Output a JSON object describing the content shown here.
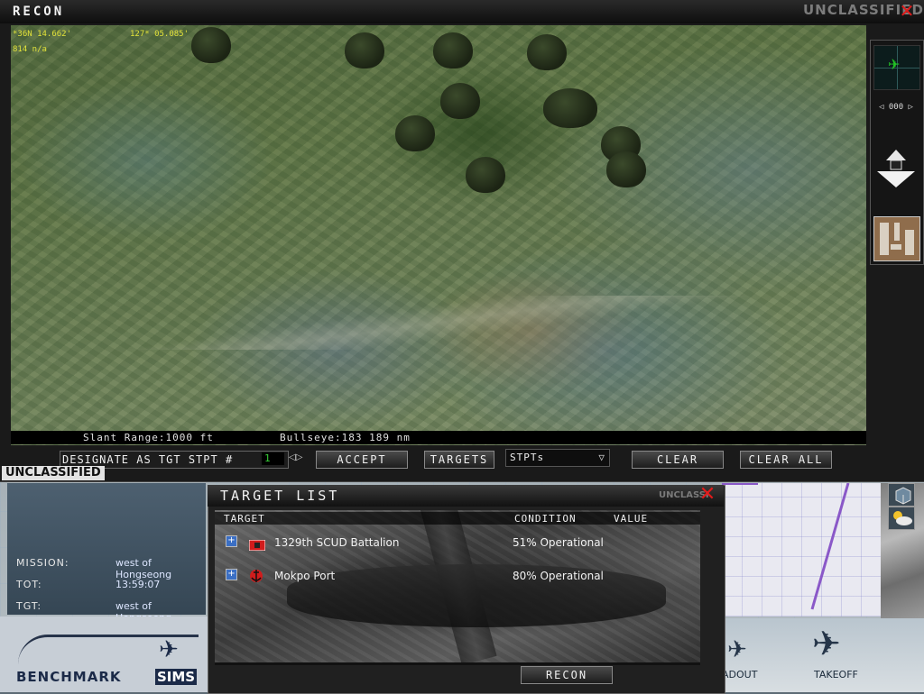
{
  "recon": {
    "title": "RECON",
    "unclass_top": "UNCLASSIFIED",
    "close_glyph": "✕",
    "coords": {
      "lat": "*36N 14.662'",
      "lon": "127* 05.085'",
      "elev": "814 n/a"
    },
    "status": {
      "slant_range": "Slant Range:1000 ft",
      "bullseye": "Bullseye:183  189 nm"
    },
    "heading_row": "◁ 000 ▷",
    "designate_label": "DESIGNATE AS TGT STPT #",
    "stpt_number": "1",
    "stpt_arrows": "◁▷",
    "buttons": {
      "accept": "ACCEPT",
      "targets": "TARGETS",
      "clear": "CLEAR",
      "clear_all": "CLEAR ALL"
    },
    "stpt_select": {
      "selected": "STPTs"
    },
    "unclass_left": "UNCLASSIFIED"
  },
  "mission": {
    "mission_label": "MISSION:",
    "mission_value": "west of Hongseong",
    "tot_label": "TOT:",
    "tot_value": "13:59:07",
    "tgt_label": "TGT:",
    "tgt_value": "west of Hongseong",
    "logo_text_1": "BENCHMARK",
    "logo_text_2": "SIMS"
  },
  "side": {
    "loadout": "ADOUT",
    "takeoff": "TAKEOFF"
  },
  "target_list": {
    "title": "TARGET LIST",
    "unclass": "UNCLASSI",
    "close_glyph": "✕",
    "headers": {
      "target": "TARGET",
      "condition": "CONDITION",
      "value": "VALUE"
    },
    "rows": [
      {
        "expand": "+",
        "name": "1329th SCUD Battalion",
        "condition": "51% Operational"
      },
      {
        "expand": "+",
        "name": "Mokpo Port",
        "condition": "80% Operational"
      }
    ],
    "recon_button": "RECON"
  },
  "icons": [
    "close-icon",
    "plane-icon",
    "zoom-arrows-icon",
    "map-thumbnail-icon",
    "scud-icon",
    "port-anchor-icon",
    "chevron-down-icon",
    "weather-icon",
    "cube-icon"
  ],
  "colors": {
    "accent_red": "#e21b1b",
    "coord_yellow": "#e2e23a",
    "stpt_green": "#38d038"
  }
}
